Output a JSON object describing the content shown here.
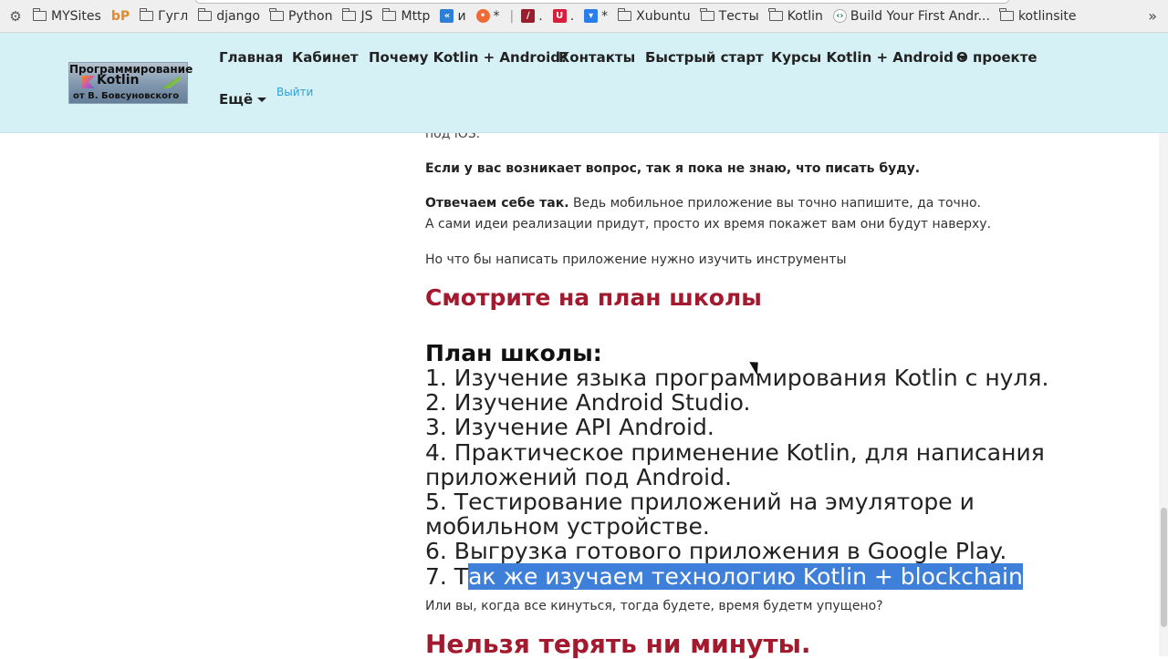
{
  "bookmarks": [
    {
      "label": "MYSites",
      "kind": "folder"
    },
    {
      "label": "bP",
      "kind": "site"
    },
    {
      "label": "Гугл",
      "kind": "folder"
    },
    {
      "label": "django",
      "kind": "folder"
    },
    {
      "label": "Python",
      "kind": "folder"
    },
    {
      "label": "JS",
      "kind": "folder"
    },
    {
      "label": "Mttp",
      "kind": "folder"
    },
    {
      "label": "и",
      "kind": "site"
    },
    {
      "label": "*",
      "kind": "site"
    },
    {
      "label": ".",
      "kind": "site"
    },
    {
      "label": ".",
      "kind": "site"
    },
    {
      "label": "*",
      "kind": "site"
    },
    {
      "label": "Xubuntu",
      "kind": "folder"
    },
    {
      "label": "Тесты",
      "kind": "folder"
    },
    {
      "label": "Kotlin",
      "kind": "folder"
    },
    {
      "label": "Build Your First Andr...",
      "kind": "site"
    },
    {
      "label": "kotlinsite",
      "kind": "folder"
    }
  ],
  "logo": {
    "line1": "Программирование",
    "line2": "Kotlin",
    "line3": "от В. Бовсуновского"
  },
  "nav": {
    "items": [
      "Главная",
      "Кабинет",
      "Почему Kotlin + Android?",
      "Контакты",
      "Быстрый старт",
      "Курсы Kotlin + Android",
      "О проекте"
    ],
    "more": "Ещё",
    "logout": "Выйти"
  },
  "content": {
    "clipped_line": "под iOS.",
    "question": "Если у вас возникает вопрос, так я пока не знаю, что писать буду.",
    "answer_bold": "Отвечаем себе так.",
    "answer_rest": " Ведь мобильное приложение вы точно напишите, да точно.",
    "answer_line2": "А сами идеи реализации придут, просто их время покажет вам они будут наверху.",
    "tools_line": "Но что бы написать приложение нужно изучить инструменты",
    "heading_plan": "Смотрите на план школы",
    "plan_title": "План школы:",
    "plan_items": [
      "1. Изучение языка программирования Kotlin с нуля.",
      "2. Изучение Android Studio.",
      "3. Изучение API Android.",
      "4. Практическое применение Kotlin, для написания",
      "приложений под Android.",
      "5. Тестирование приложений на эмуляторе и",
      "мобильном устройстве.",
      "6. Выгрузка готового приложения в Google Play."
    ],
    "plan_item7_plain": "7. Т",
    "plan_item7_selected": "ак же изучаем технологию Kotlin + blockchain",
    "after_plan": "Или вы, когда все кинуться, тогда будете, время будетм упущено?",
    "heading_bottom": "Нельзя терять ни минуты."
  }
}
